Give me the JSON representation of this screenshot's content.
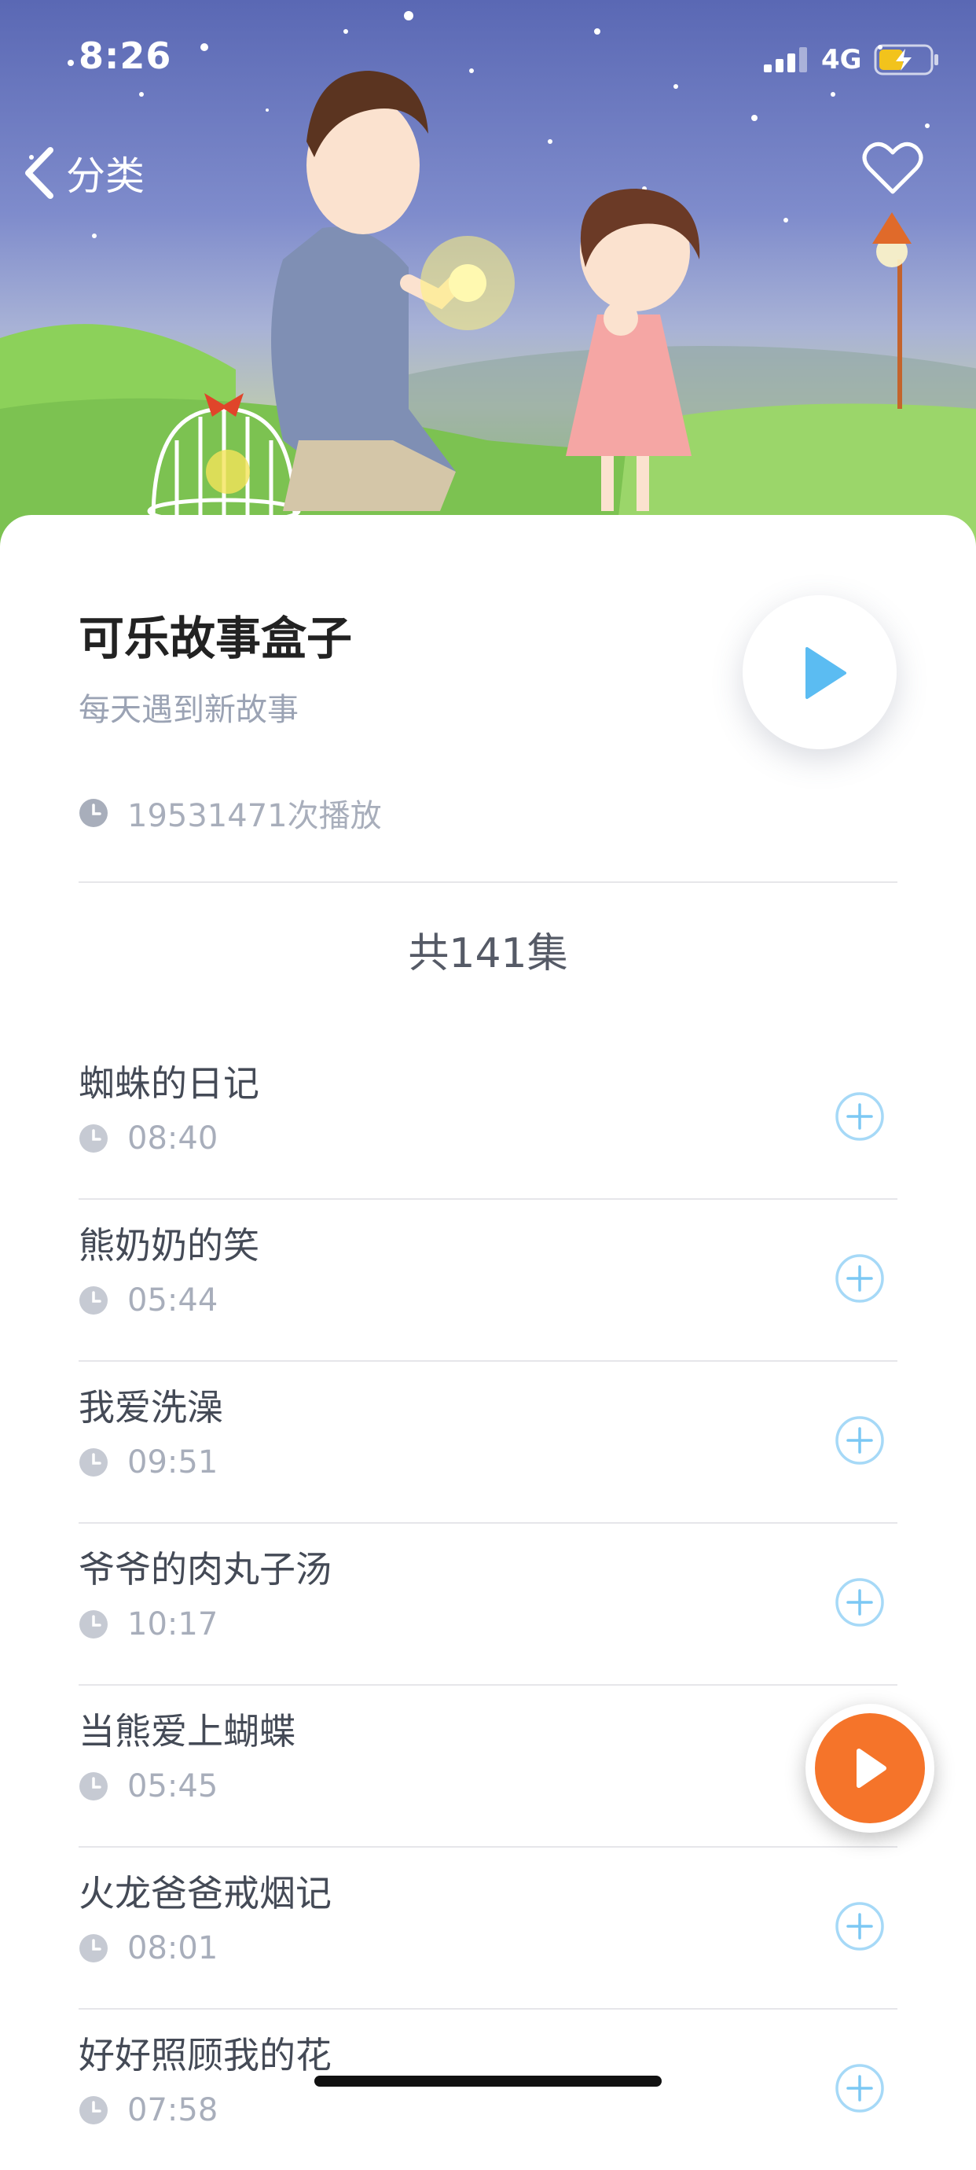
{
  "status_bar": {
    "time": "8:26",
    "network": "4G"
  },
  "nav": {
    "back_label": "分类"
  },
  "album": {
    "title": "可乐故事盒子",
    "subtitle": "每天遇到新故事",
    "plays": "19531471次播放",
    "episode_count": "共141集"
  },
  "episodes": [
    {
      "title": "蜘蛛的日记",
      "duration": "08:40"
    },
    {
      "title": "熊奶奶的笑",
      "duration": "05:44"
    },
    {
      "title": "我爱洗澡",
      "duration": "09:51"
    },
    {
      "title": "爷爷的肉丸子汤",
      "duration": "10:17"
    },
    {
      "title": "当熊爱上蝴蝶",
      "duration": "05:45"
    },
    {
      "title": "火龙爸爸戒烟记",
      "duration": "08:01"
    },
    {
      "title": "好好照顾我的花",
      "duration": "07:58"
    }
  ],
  "colors": {
    "accent_blue": "#5bbcf2",
    "player_orange": "#f5742a",
    "hero_sky": "#6f7cc2",
    "hero_grass": "#86c860"
  },
  "icons": {
    "back": "chevron-left-icon",
    "favorite": "heart-outline-icon",
    "play": "play-icon",
    "clock": "clock-icon",
    "add": "plus-circle-icon"
  }
}
